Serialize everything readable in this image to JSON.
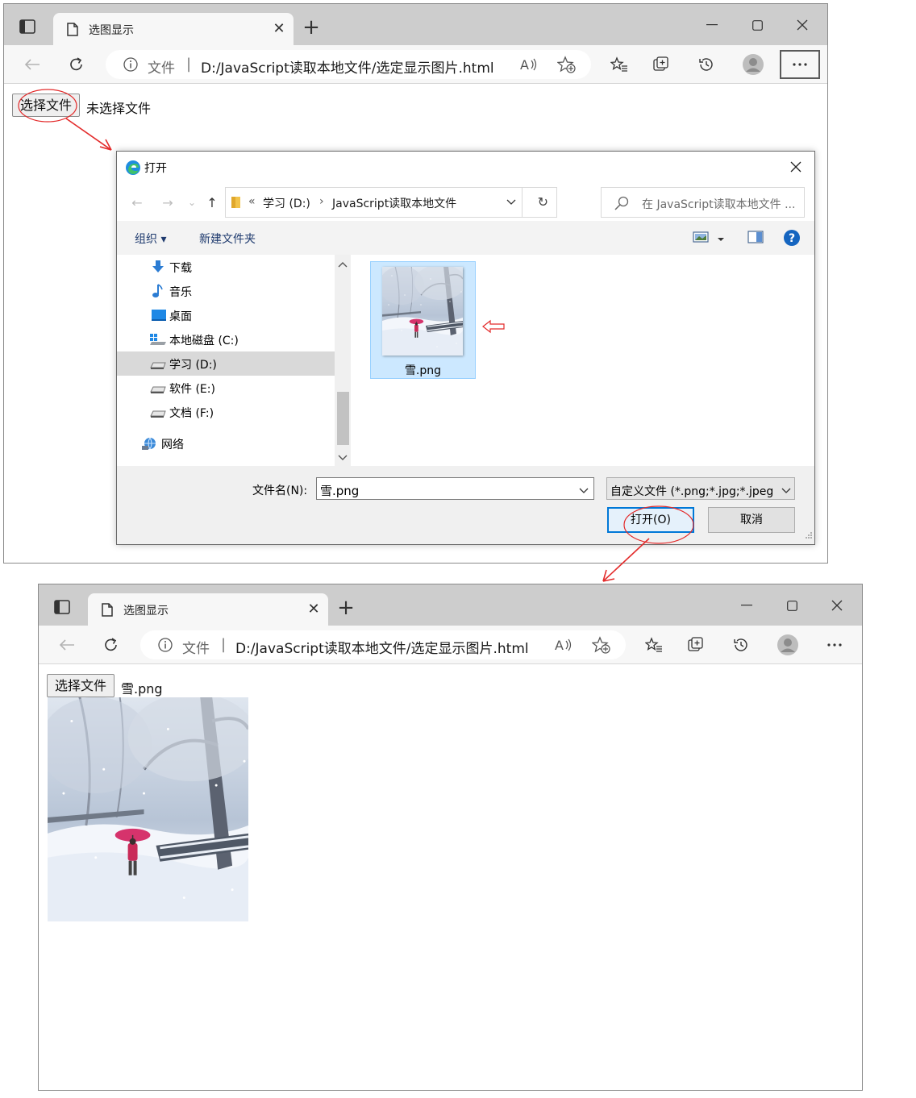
{
  "browser_top": {
    "tab_title": "选图显示",
    "address_scheme": "文件",
    "address_url": "D:/JavaScript读取本地文件/选定显示图片.html",
    "file_button_label": "选择文件",
    "file_status": "未选择文件"
  },
  "dialog": {
    "title": "打开",
    "breadcrumb": [
      "«",
      "学习 (D:)",
      "›",
      "JavaScript读取本地文件"
    ],
    "search_placeholder": "在 JavaScript读取本地文件 ...",
    "commands": {
      "organize": "组织 ▾",
      "new_folder": "新建文件夹"
    },
    "nav_items": [
      {
        "label": "下载",
        "icon": "download-icon"
      },
      {
        "label": "音乐",
        "icon": "music-icon"
      },
      {
        "label": "桌面",
        "icon": "desktop-icon"
      },
      {
        "label": "本地磁盘 (C:)",
        "icon": "windows-drive-icon"
      },
      {
        "label": "学习 (D:)",
        "icon": "drive-icon",
        "selected": true
      },
      {
        "label": "软件 (E:)",
        "icon": "drive-icon"
      },
      {
        "label": "文档 (F:)",
        "icon": "drive-icon"
      },
      {
        "label": "网络",
        "icon": "network-icon"
      }
    ],
    "file": {
      "name": "雪.png"
    },
    "filename_label": "文件名(N):",
    "filename_value": "雪.png",
    "filter_value": "自定义文件 (*.png;*.jpg;*.jpeg",
    "open_label": "打开(O)",
    "cancel_label": "取消"
  },
  "browser_bottom": {
    "tab_title": "选图显示",
    "address_scheme": "文件",
    "address_url": "D:/JavaScript读取本地文件/选定显示图片.html",
    "file_button_label": "选择文件",
    "file_status": "雪.png"
  },
  "colors": {
    "annotation": "#e32b2b",
    "accent": "#0078d7",
    "selection": "#cce8ff"
  }
}
